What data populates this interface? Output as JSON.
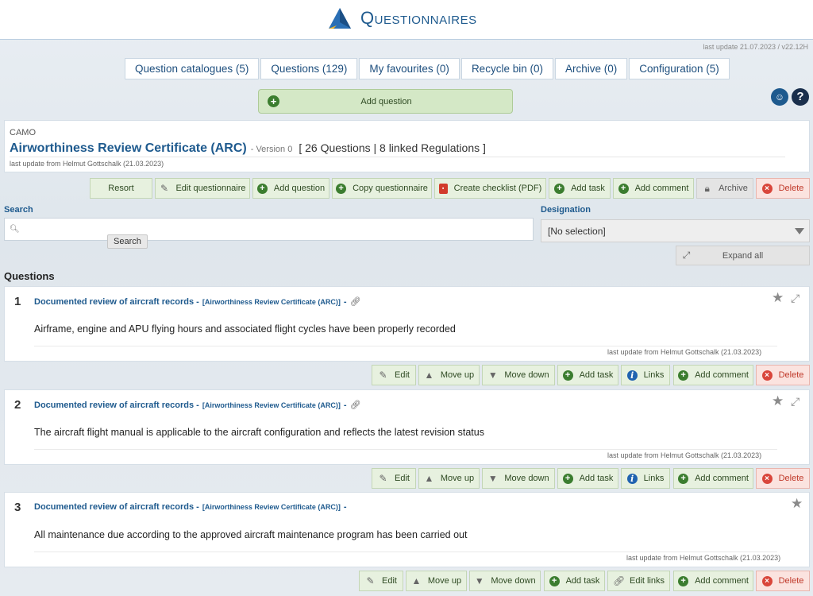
{
  "app": {
    "title": "Questionnaires",
    "version_text": "last update 21.07.2023 / v22.12H"
  },
  "tabs": [
    {
      "label": "Question catalogues (5)"
    },
    {
      "label": "Questions (129)"
    },
    {
      "label": "My favourites (0)"
    },
    {
      "label": "Recycle bin (0)"
    },
    {
      "label": "Archive (0)"
    },
    {
      "label": "Configuration (5)"
    }
  ],
  "add_question_button": {
    "label": "Add question"
  },
  "questionnaire": {
    "section": "CAMO",
    "title": "Airworthiness Review Certificate (ARC)",
    "version": "- Version 0",
    "stats": "[ 26 Questions | 8 linked Regulations ]",
    "updated": "last update from Helmut Gottschalk (21.03.2023)"
  },
  "toolbar": {
    "resort": "Resort",
    "edit_questionnaire": "Edit questionnaire",
    "add_question": "Add question",
    "copy_questionnaire": "Copy questionnaire",
    "create_checklist": "Create checklist (PDF)",
    "add_task": "Add task",
    "add_comment": "Add comment",
    "archive": "Archive",
    "delete": "Delete"
  },
  "search": {
    "label": "Search",
    "value": "",
    "tooltip": "Search"
  },
  "designation": {
    "label": "Designation",
    "selected": "[No selection]"
  },
  "expand_all": "Expand all",
  "questions_title": "Questions",
  "question_actions": {
    "edit": "Edit",
    "move_up": "Move up",
    "move_down": "Move down",
    "add_task": "Add task",
    "links": "Links",
    "edit_links": "Edit links",
    "add_comment": "Add comment",
    "delete": "Delete"
  },
  "questions": [
    {
      "number": "1",
      "category": "Documented review of aircraft records -",
      "reference": "[Airworthiness Review Certificate (ARC)]",
      "text": "Airframe, engine and APU flying hours and associated flight cycles have been properly recorded",
      "updated": "last update from Helmut Gottschalk (21.03.2023)"
    },
    {
      "number": "2",
      "category": "Documented review of aircraft records -",
      "reference": "[Airworthiness Review Certificate (ARC)]",
      "text": "The aircraft flight manual is applicable to the aircraft configuration and reflects the latest revision status",
      "updated": "last update from Helmut Gottschalk (21.03.2023)"
    },
    {
      "number": "3",
      "category": "Documented review of aircraft records -",
      "reference": "[Airworthiness Review Certificate (ARC)]",
      "text": "All maintenance due according to the approved aircraft maintenance program has been carried out",
      "updated": "last update from Helmut Gottschalk (21.03.2023)"
    }
  ],
  "colors": {
    "accent": "#1e5a8e",
    "button_green": "#e7f1df",
    "delete_red": "#d9463b"
  }
}
